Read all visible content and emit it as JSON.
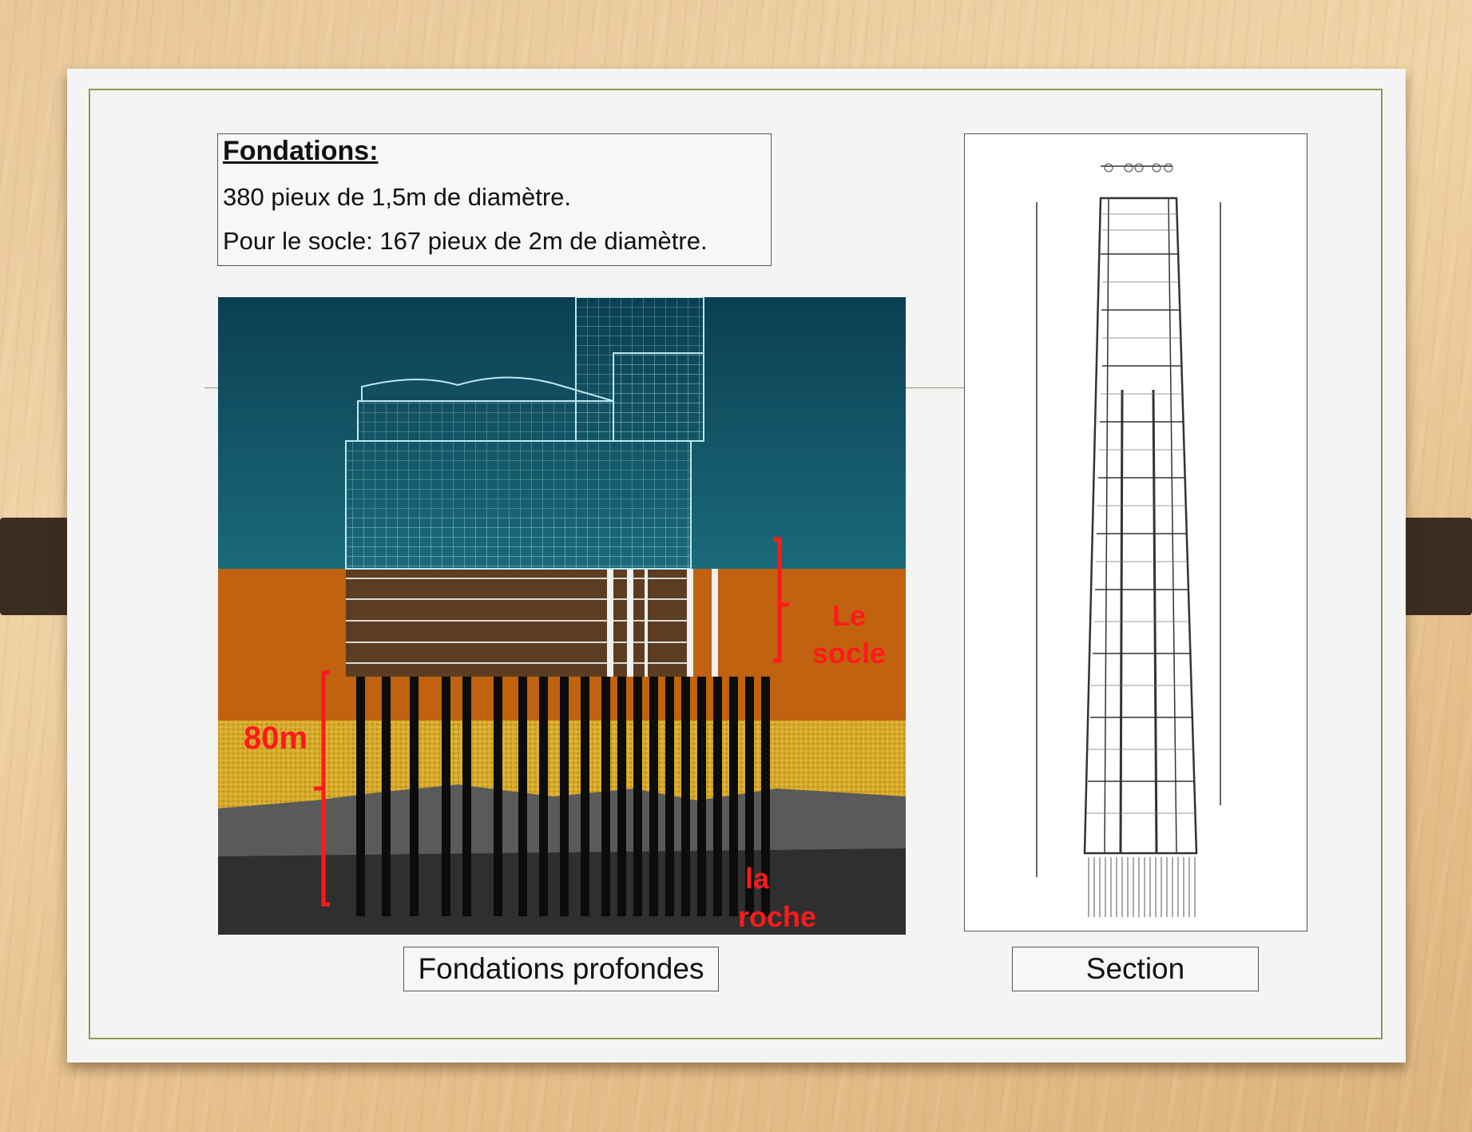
{
  "textbox": {
    "title": "Fondations:",
    "line1": "380 pieux de 1,5m de diamètre.",
    "line2": "Pour le socle: 167 pieux de 2m de diamètre."
  },
  "figure_left": {
    "label_socle_1": "Le",
    "label_socle_2": "socle",
    "label_depth": "80m",
    "label_rock_1": "la",
    "label_rock_2": "roche",
    "caption": "Fondations profondes"
  },
  "figure_right": {
    "caption": "Section"
  },
  "colors": {
    "accent_line": "#8a9a52",
    "label_red": "#ff1a1a",
    "sky": "#0f4b5c",
    "clay": "#c0620f",
    "sand": "#d6aa2a",
    "rock": "#3a3a3a"
  }
}
